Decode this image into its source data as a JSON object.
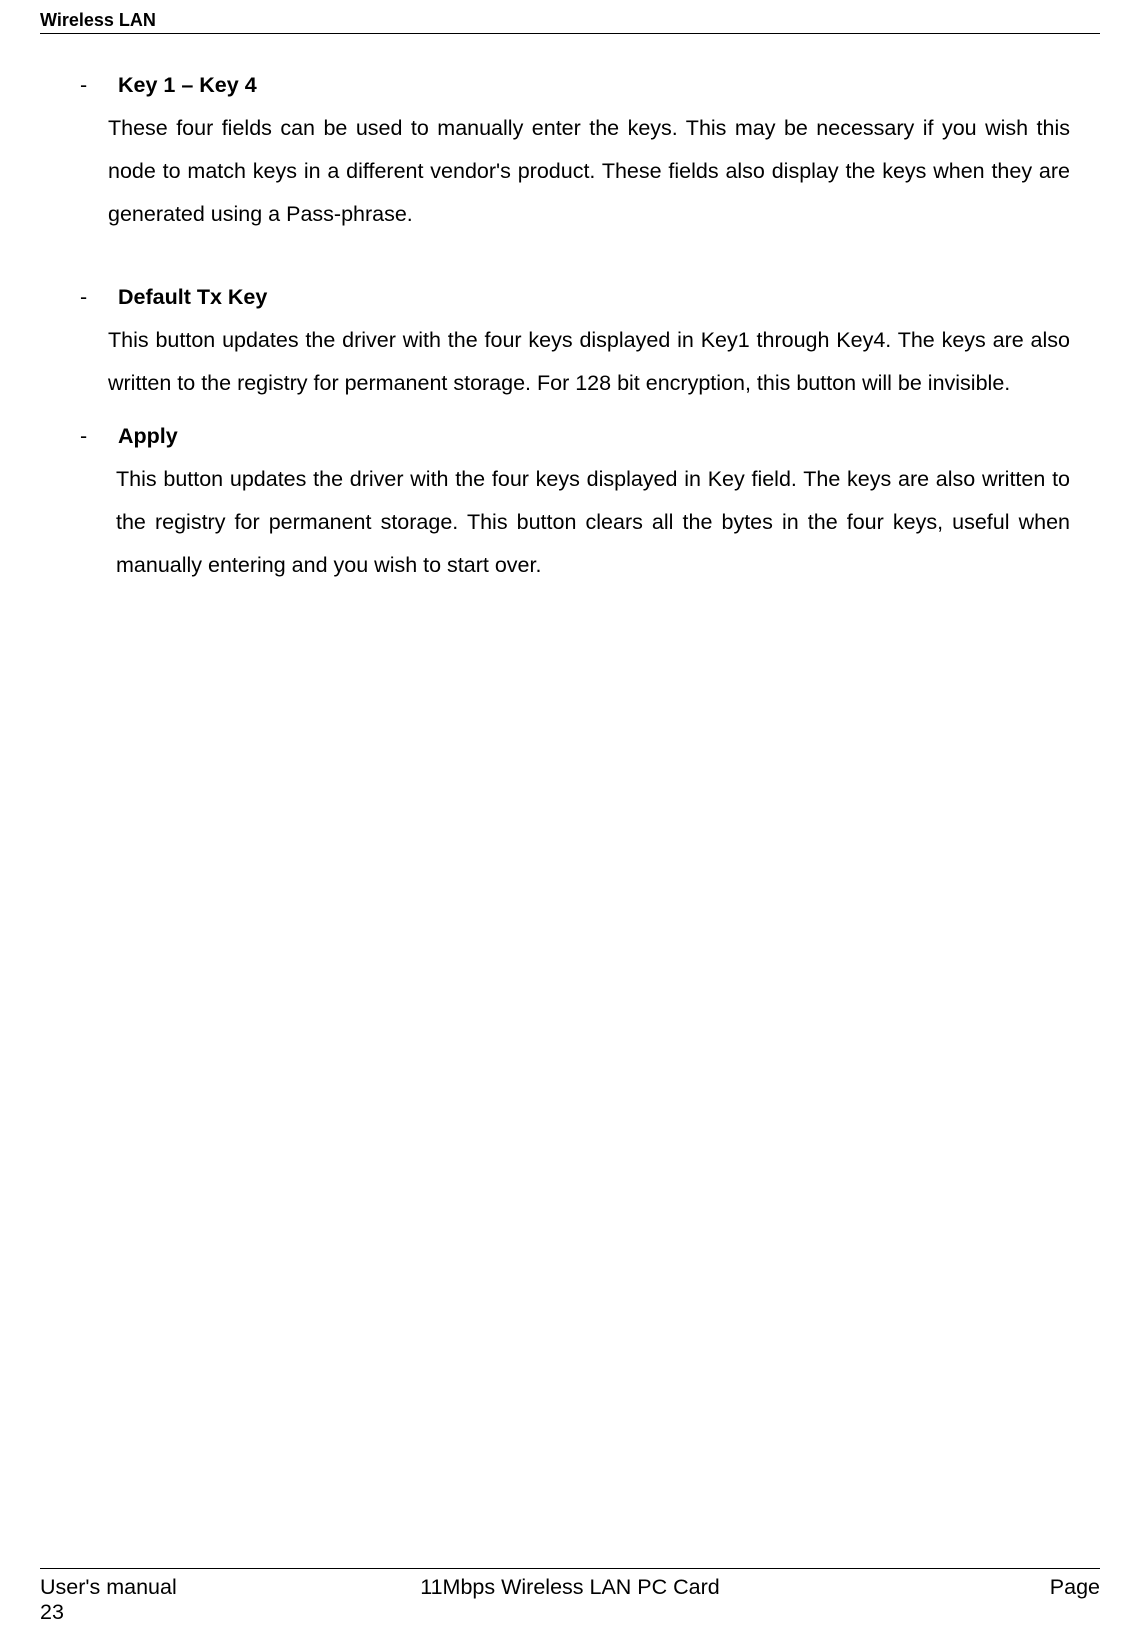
{
  "header": {
    "title": "Wireless LAN"
  },
  "body": {
    "items": [
      {
        "bullet": "-",
        "heading": "Key 1 – Key 4",
        "text": "These four fields can be used to manually enter the keys. This may be necessary if you wish this node to match keys in a different vendor's product. These fields also display the keys when they are generated using a Pass-phrase.",
        "indented": false,
        "gap_after": true
      },
      {
        "bullet": "-",
        "heading": "Default Tx Key",
        "text": "This button updates the driver with the four keys displayed in Key1 through Key4.  The keys are also written to the registry for permanent storage. For 128 bit encryption, this button will be invisible.",
        "indented": false,
        "gap_after": false
      },
      {
        "bullet": "-",
        "heading": "Apply",
        "text": "This button updates the driver with the four keys displayed in Key field. The keys are also written to the registry for permanent storage. This button clears all the bytes in the four keys, useful when manually entering and you wish to start over.",
        "indented": true,
        "gap_after": false
      }
    ]
  },
  "footer": {
    "left": "User's manual",
    "center": "11Mbps Wireless LAN PC Card",
    "right": "Page",
    "pagenum": "23"
  }
}
